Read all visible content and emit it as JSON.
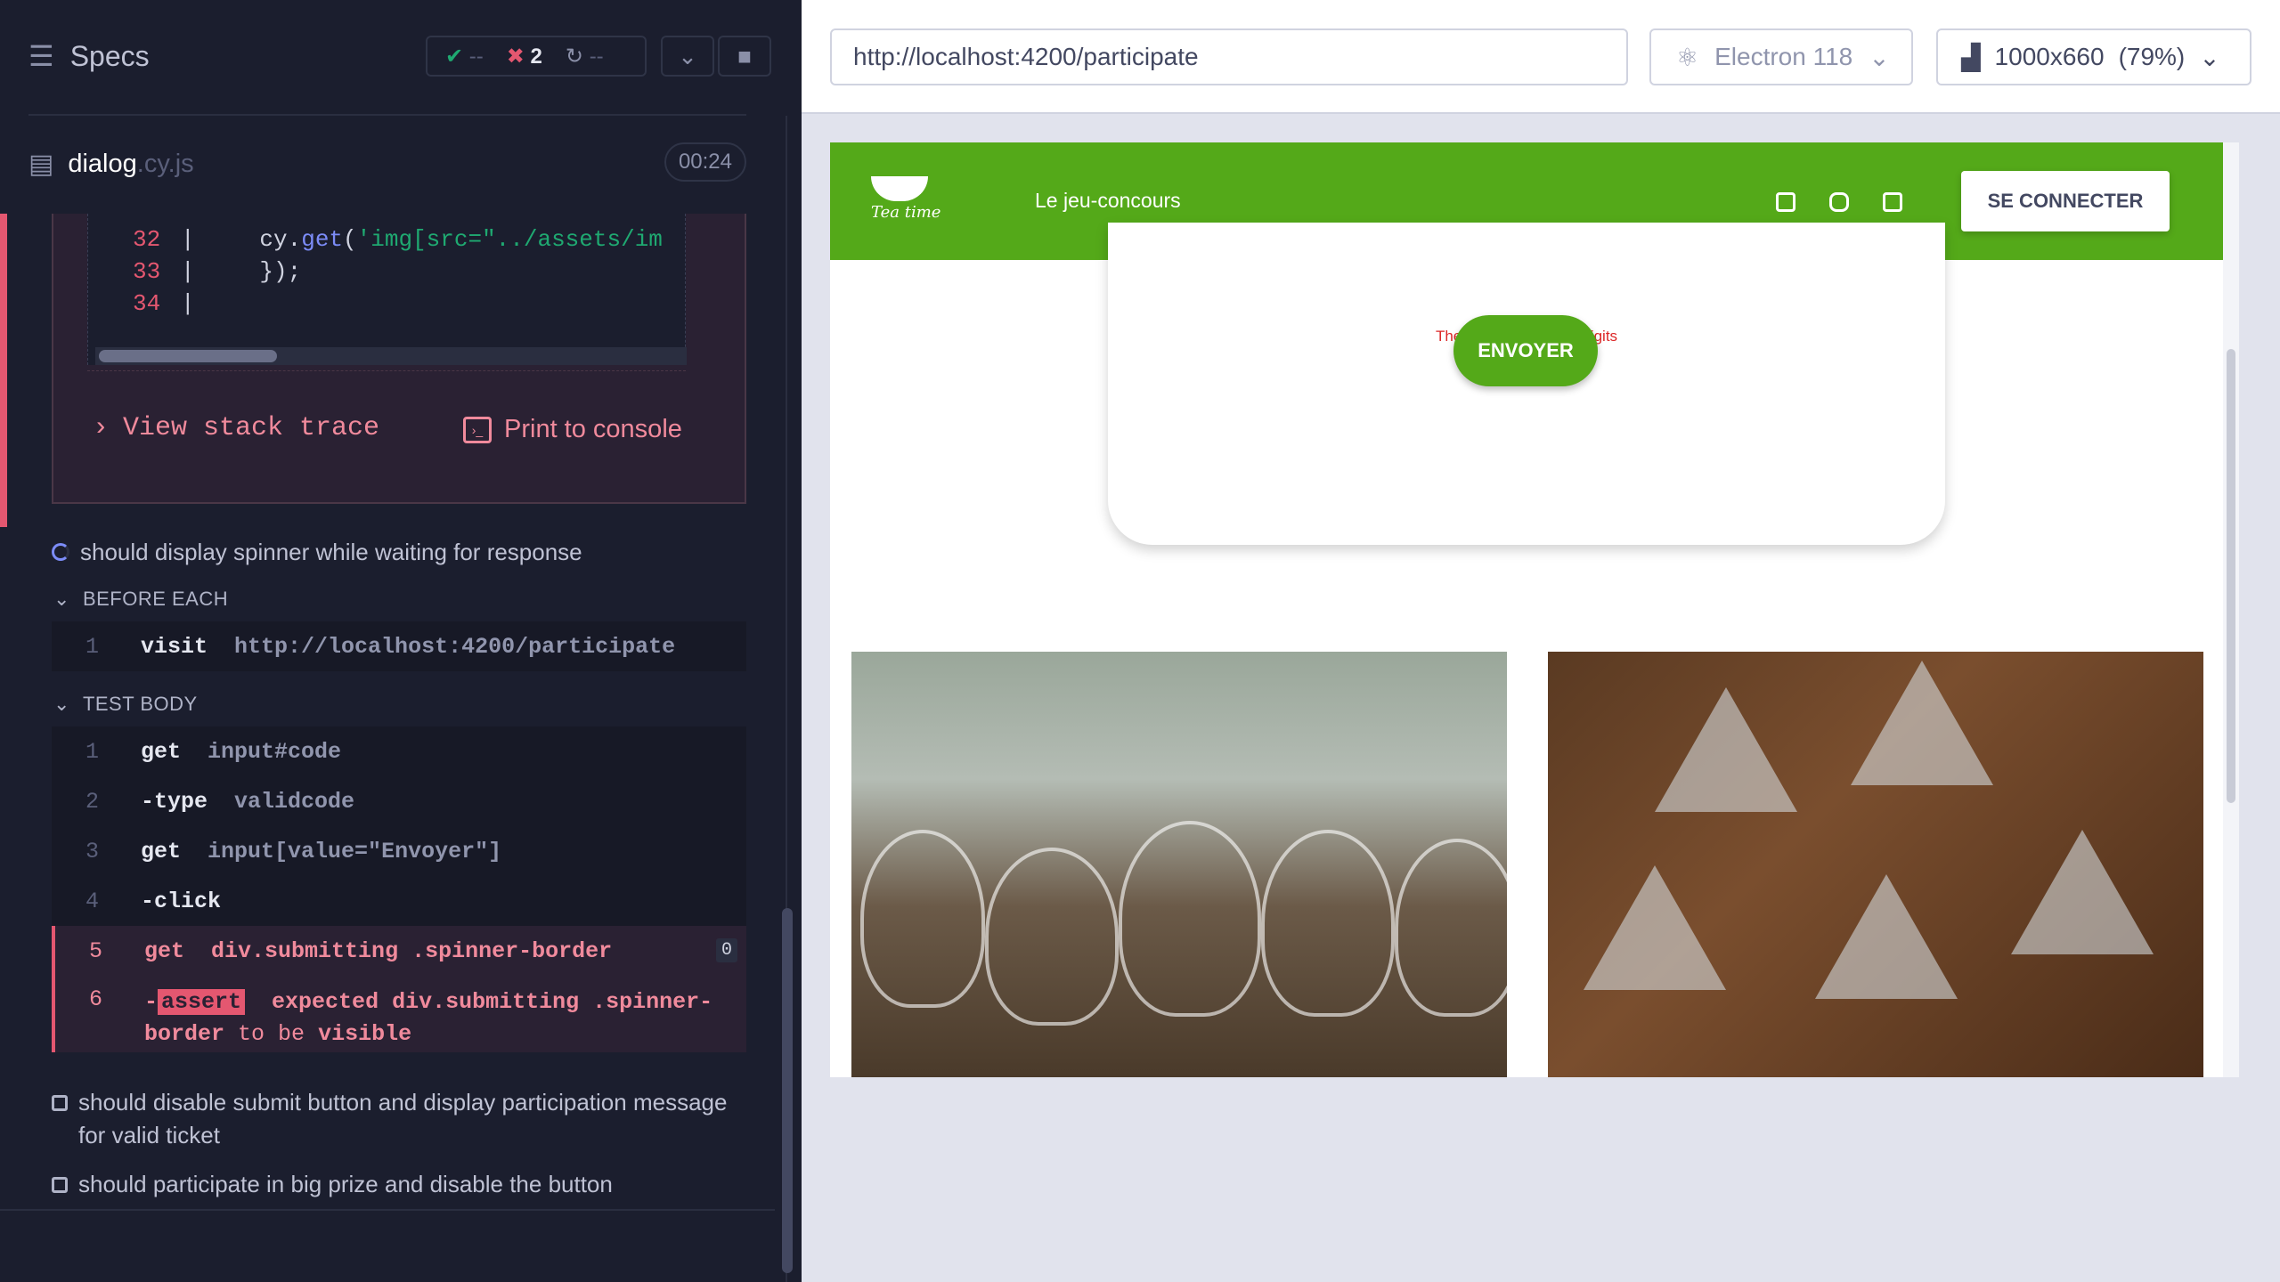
{
  "runner": {
    "specs_label": "Specs",
    "stats": {
      "passed": "--",
      "failed": "2",
      "pending": "--"
    },
    "file_name": "dialog",
    "file_ext": ".cy.js",
    "timer": "00:24"
  },
  "error": {
    "code_lines": [
      {
        "num": "32",
        "text": "        cy.get('img[src=\"../assets/im"
      },
      {
        "num": "33",
        "text": "    });"
      },
      {
        "num": "34",
        "text": ""
      }
    ],
    "view_stack_trace": "View stack trace",
    "print_to_console": "Print to console"
  },
  "tests": [
    {
      "title": "should display spinner while waiting for response",
      "state": "running"
    },
    {
      "title": "should disable submit button and display participation message for valid ticket",
      "state": "queued"
    },
    {
      "title": "should participate in big prize and disable the button",
      "state": "queued"
    }
  ],
  "before_each": {
    "label": "BEFORE EACH",
    "commands": [
      {
        "n": "1",
        "name": "visit",
        "arg": "http://localhost:4200/participate"
      }
    ]
  },
  "test_body": {
    "label": "TEST BODY",
    "commands": [
      {
        "n": "1",
        "name": "get",
        "arg": "input#code"
      },
      {
        "n": "2",
        "name": "-type",
        "arg": "validcode"
      },
      {
        "n": "3",
        "name": "get",
        "arg": "input[value=\"Envoyer\"]"
      },
      {
        "n": "4",
        "name": "-click",
        "arg": ""
      },
      {
        "n": "5",
        "name": "get",
        "arg": "div.submitting .spinner-border",
        "badge": "0"
      },
      {
        "n": "6",
        "name": "-",
        "assert": "assert",
        "line1": "expected div.submitting .spinner-",
        "line2a": "border",
        "line2b": "to be",
        "line2c": "visible"
      }
    ]
  },
  "browser_bar": {
    "url": "http://localhost:4200/participate",
    "browser": "Electron 118",
    "viewport": "1000x660",
    "zoom": "(79%)"
  },
  "app": {
    "brand": "Tea time",
    "nav_title": "Le jeu-concours",
    "login_button": "SE CONNECTER",
    "error_text": "The code must be 10 digits",
    "send_button": "ENVOYER"
  },
  "colors": {
    "accent_green": "#54a919",
    "error_red": "#e45770",
    "pass_green": "#1fa971"
  }
}
